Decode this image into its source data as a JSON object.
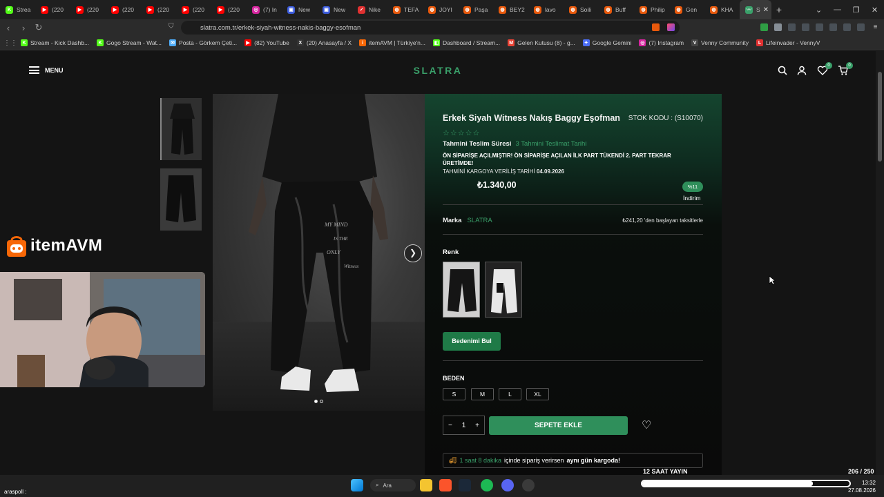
{
  "browser": {
    "tabs": [
      {
        "label": "Strea",
        "color": "#53fc18",
        "glyph": "K"
      },
      {
        "label": "(220",
        "color": "#ff0000",
        "glyph": "▶"
      },
      {
        "label": "(220",
        "color": "#ff0000",
        "glyph": "▶"
      },
      {
        "label": "(220",
        "color": "#ff0000",
        "glyph": "▶"
      },
      {
        "label": "(220",
        "color": "#ff0000",
        "glyph": "▶"
      },
      {
        "label": "(220",
        "color": "#ff0000",
        "glyph": "▶"
      },
      {
        "label": "(220",
        "color": "#ff0000",
        "glyph": "▶"
      },
      {
        "label": "(7) In",
        "color": "#d6249f",
        "glyph": "◎"
      },
      {
        "label": "New",
        "color": "#3b5bdb",
        "glyph": "▣"
      },
      {
        "label": "New",
        "color": "#3b5bdb",
        "glyph": "▣"
      },
      {
        "label": "Nike",
        "color": "#e03131",
        "glyph": "✓"
      },
      {
        "label": "TEFA",
        "color": "#e8590c",
        "glyph": "◍"
      },
      {
        "label": "JOYI",
        "color": "#e8590c",
        "glyph": "◍"
      },
      {
        "label": "Paşa",
        "color": "#e8590c",
        "glyph": "◍"
      },
      {
        "label": "BEY2",
        "color": "#e8590c",
        "glyph": "◍"
      },
      {
        "label": "lavo",
        "color": "#e8590c",
        "glyph": "◍"
      },
      {
        "label": "Soili",
        "color": "#e8590c",
        "glyph": "◍"
      },
      {
        "label": "Buff",
        "color": "#e8590c",
        "glyph": "◍"
      },
      {
        "label": "Philip",
        "color": "#e8590c",
        "glyph": "◍"
      },
      {
        "label": "Gen",
        "color": "#e8590c",
        "glyph": "◍"
      },
      {
        "label": "KHA",
        "color": "#e8590c",
        "glyph": "◍"
      },
      {
        "label": "S",
        "color": "#3aa06a",
        "glyph": "〰",
        "active": true
      }
    ],
    "url": "slatra.com.tr/erkek-siyah-witness-nakis-baggy-esofman",
    "bookmarks": [
      {
        "label": "Stream - Kick Dashb...",
        "color": "#53fc18",
        "glyph": "K"
      },
      {
        "label": "Gogo Stream - Wat...",
        "color": "#53fc18",
        "glyph": "K"
      },
      {
        "label": "Posta - Görkem Çeti...",
        "color": "#4dabf7",
        "glyph": "✉"
      },
      {
        "label": "(82) YouTube",
        "color": "#ff0000",
        "glyph": "▶"
      },
      {
        "label": "(20) Anasayfa / X",
        "color": "#333333",
        "glyph": "X"
      },
      {
        "label": "itemAVM | Türkiye'n...",
        "color": "#f76707",
        "glyph": "i"
      },
      {
        "label": "Dashboard / Stream...",
        "color": "#53fc18",
        "glyph": "◧"
      },
      {
        "label": "Gelen Kutusu (8) - g...",
        "color": "#ea4335",
        "glyph": "M"
      },
      {
        "label": "Google Gemini",
        "color": "#4c6ef5",
        "glyph": "✦"
      },
      {
        "label": "(7) Instagram",
        "color": "#d6249f",
        "glyph": "◎"
      },
      {
        "label": "Venny Community",
        "color": "#444444",
        "glyph": "V"
      },
      {
        "label": "Lifeinvader - VennyV",
        "color": "#e03131",
        "glyph": "L"
      }
    ]
  },
  "site": {
    "menu_label": "MENU",
    "logo": "SLATRA",
    "wishlist_count": "0",
    "cart_count": "0"
  },
  "product": {
    "title": "Erkek Siyah Witness Nakış Baggy Eşofman",
    "sku": "STOK KODU : (S10070)",
    "stars": "☆☆☆☆☆",
    "delivery_label": "Tahmini Teslim Süresi",
    "delivery_value": "3 Tahmini Teslimat Tarihi",
    "preorder_note": "ÖN SİPARİŞE AÇILMIŞTIR! ÖN SİPARİŞE AÇILAN İLK PART TÜKENDİ 2. PART TEKRAR ÜRETİMDE!",
    "cargo_label": "TAHMİNİ KARGOYA VERİLİŞ TARİHİ",
    "cargo_date": "04.09.2026",
    "price": "₺1.340,00",
    "discount_badge": "%11",
    "discount_label": "İndirim",
    "brand_label": "Marka",
    "brand_value": "SLATRA",
    "installment": "₺241,20 'den başlayan taksitlerle",
    "color_label": "Renk",
    "find_size_label": "Bedenimi Bul",
    "size_label": "BEDEN",
    "sizes": [
      "S",
      "M",
      "L",
      "XL"
    ],
    "quantity": "1",
    "add_to_cart_label": "SEPETE EKLE",
    "shipping_highlight": "1 saat 8 dakika",
    "shipping_text": "içinde sipariş verirsen",
    "shipping_bold": "aynı gün kargoda!",
    "image_text": [
      "MY MIND",
      "IS THE",
      "ONLY",
      "Witness"
    ]
  },
  "overlay": {
    "sponsor_logo": "itemAVM",
    "stream_label": "12 SAAT YAYIN",
    "stream_count": "206 / 250",
    "stream_progress": 0.824,
    "chat_user": "araspoll :"
  },
  "taskbar": {
    "search_label": "Ara",
    "time": "13:32",
    "date": "27.08.2026"
  }
}
